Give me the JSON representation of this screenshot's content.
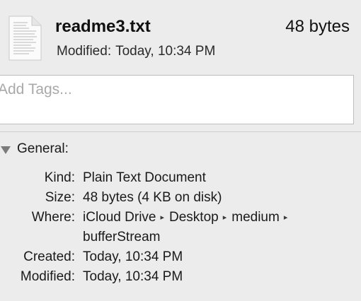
{
  "file": {
    "name": "readme3.txt",
    "size": "48 bytes",
    "modified_label": "Modified:",
    "modified_value": "Today, 10:34 PM",
    "icon": "text-document-icon"
  },
  "tags": {
    "placeholder": "Add Tags..."
  },
  "general": {
    "title": "General:",
    "kind_label": "Kind:",
    "kind_value": "Plain Text Document",
    "size_label": "Size:",
    "size_value": "48 bytes (4 KB on disk)",
    "where_label": "Where:",
    "where_path": [
      "iCloud Drive",
      "Desktop",
      "medium",
      "bufferStream"
    ],
    "path_separator": "▸",
    "created_label": "Created:",
    "created_value": "Today, 10:34 PM",
    "modified_label": "Modified:",
    "modified_value": "Today, 10:34 PM"
  },
  "colors": {
    "background": "#ececec",
    "field_background": "#ffffff",
    "field_border": "#bdbdbd",
    "disclosure_triangle": "#7b7b7b"
  }
}
